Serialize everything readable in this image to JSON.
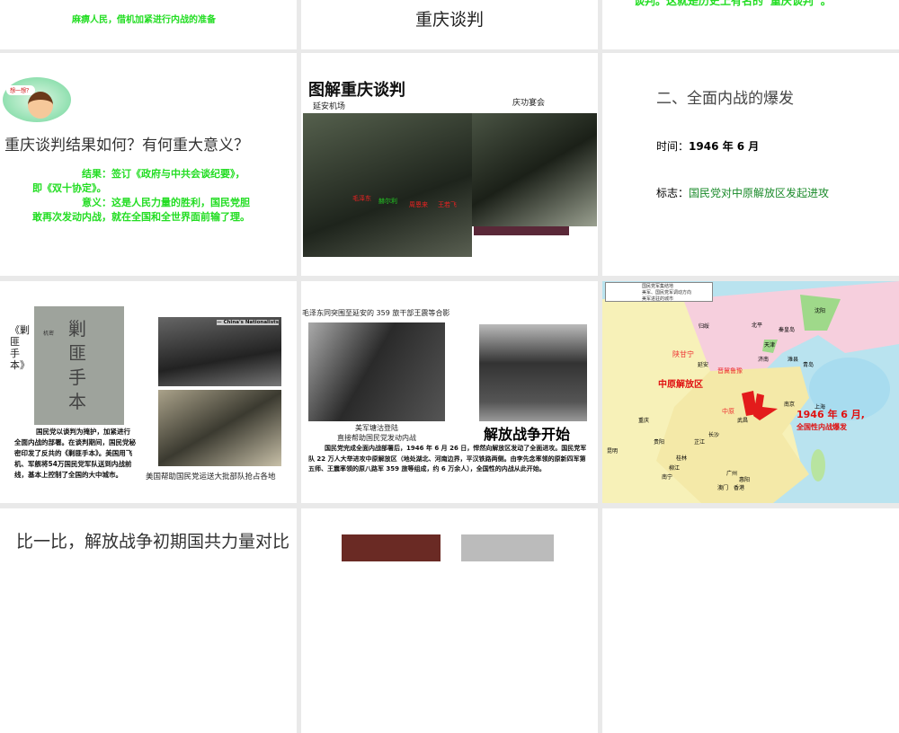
{
  "slides": [
    {
      "text": "麻痹人民，借机加紧进行内战的准备"
    },
    {
      "title": "重庆谈判"
    },
    {
      "text": "谈判。这就是历史上有名的“重庆谈判”。"
    },
    {
      "bubble": "想一想？",
      "question": "重庆谈判结果如何？有何重大意义？",
      "result": "结果：签订《政府与中共会谈纪要》，即《双十协定》。",
      "meaning": "意义：这是人民力量的胜利，国民党胆敢再次发动内战，就在全国和全世界面前输了理。"
    },
    {
      "title": "图解重庆谈判",
      "left_caption": "延安机场",
      "right_caption": "庆功宴会",
      "labels": [
        "毛泽东",
        "赫尔利",
        "周恩来",
        "王若飞"
      ]
    },
    {
      "title": "二、全面内战的爆发",
      "time_label": "时间：",
      "time_value": "1946 年 6 月",
      "mark_label": "标志：",
      "mark_value": "国民党对中原解放区发起进攻"
    },
    {
      "vertical_title": "《剿匪手本》",
      "book_title": "剿匪手本",
      "book_note": "机密",
      "body": "国民党以谈判为掩护，加紧进行全面内战的部署。在谈判期间，国民党秘密印发了反共的《剿匪手本》。美国用飞机、军舰将54万国民党军队送到内战前线，基本上控制了全国的大中城市。",
      "photo_tag": "— China's Nationalists",
      "photo_caption": "美国帮助国民党运送大批部队抢占各地"
    },
    {
      "top_caption": "毛泽东同突围至延安的 359 旅干部王震等合影",
      "left_caption_1": "美军塘沽登陆",
      "left_caption_2": "直接帮助国民党发动内战",
      "headline": "解放战争开始",
      "body": "国民党完成全面内战部署后，1946 年 6 月 26 日，悍然向解放区发动了全面进攻。国民党军队 22 万人大举进攻中原解放区（地处湖北、河南边界，平汉铁路两侧。由李先念率领的原新四军第五师、王震率领的原八路军 359 旅等组成，约 6 万余人），全国性的内战从此开始。"
    },
    {
      "legend": [
        "国民党军集结地",
        "美军、国民党军调动方向",
        "美军进驻的城市"
      ],
      "region_label": "中原解放区",
      "annotation_1": "1946 年 6 月,",
      "annotation_2": "全国性内战爆发",
      "cities": [
        "沈阳",
        "北平",
        "秦皇岛",
        "天津",
        "济南",
        "潍县",
        "青岛",
        "归绥",
        "延安",
        "南京",
        "上海",
        "武昌",
        "重庆",
        "长沙",
        "芷江",
        "贵阳",
        "昆明",
        "桂林",
        "柳江",
        "南宁",
        "广州",
        "惠阳",
        "澳门",
        "香港"
      ],
      "regions": [
        "陕甘宁",
        "晋冀鲁豫",
        "中原"
      ]
    },
    {
      "title": "比一比，解放战争初期国共力量对比"
    },
    {},
    {}
  ]
}
